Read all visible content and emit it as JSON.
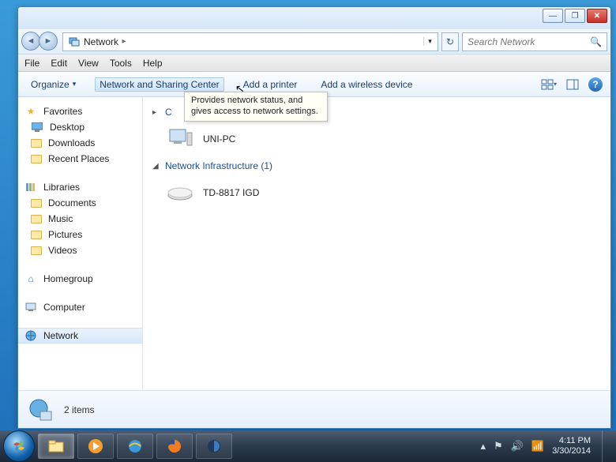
{
  "titlebar": {
    "min": "—",
    "max": "❐",
    "close": "✕"
  },
  "nav": {
    "location": "Network",
    "chevron": "▸",
    "dropdown": "▾",
    "search_placeholder": "Search Network"
  },
  "menu": {
    "file": "File",
    "edit": "Edit",
    "view": "View",
    "tools": "Tools",
    "help": "Help"
  },
  "toolbar": {
    "organize": "Organize",
    "organize_chevron": "▾",
    "nsc": "Network and Sharing Center",
    "add_printer": "Add a printer",
    "add_wireless": "Add a wireless device",
    "view_chevron": "▾"
  },
  "sidebar": {
    "favorites": "Favorites",
    "desktop": "Desktop",
    "downloads": "Downloads",
    "recent": "Recent Places",
    "libraries": "Libraries",
    "documents": "Documents",
    "music": "Music",
    "pictures": "Pictures",
    "videos": "Videos",
    "homegroup": "Homegroup",
    "computer": "Computer",
    "network": "Network"
  },
  "content": {
    "group1_label": "C",
    "group1_arrow": "▸",
    "item_pc": "UNI-PC",
    "group2_label": "Network Infrastructure (1)",
    "group2_arrow": "◢",
    "item_router": "TD-8817 IGD"
  },
  "tooltip": "Provides network status, and gives access to network settings.",
  "statusbar": {
    "items": "2 items"
  },
  "tray": {
    "time": "4:11 PM",
    "date": "3/30/2014"
  },
  "icons": {
    "back": "◄",
    "fwd": "►",
    "refresh": "↻",
    "search": "🔍"
  }
}
